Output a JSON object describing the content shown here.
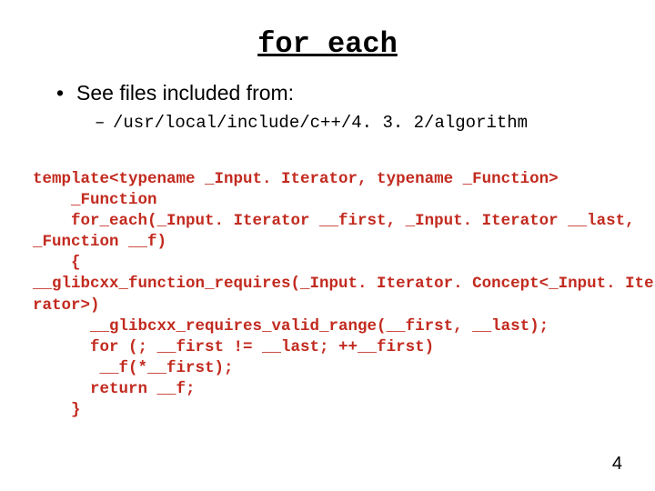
{
  "title": "for_each",
  "bullet1": "See files included from:",
  "bullet2": "/usr/local/include/c++/4. 3. 2/algorithm",
  "code": {
    "l1": "template<typename _Input. Iterator, typename _Function>",
    "l2": "    _Function",
    "l3": "    for_each(_Input. Iterator __first, _Input. Iterator __last,",
    "l4": "_Function __f)",
    "l5": "    {",
    "l6": "__glibcxx_function_requires(_Input. Iterator. Concept<_Input. Ite",
    "l7": "rator>)",
    "l8": "      __glibcxx_requires_valid_range(__first, __last);",
    "l9": "      for (; __first != __last; ++__first)",
    "l10": "       __f(*__first);",
    "l11": "      return __f;",
    "l12": "    }"
  },
  "page_number": "4"
}
